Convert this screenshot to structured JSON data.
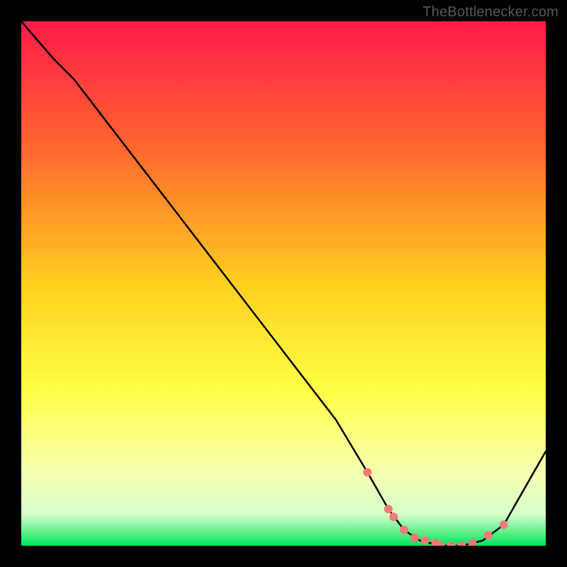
{
  "watermark": "TheBottlenecker.com",
  "chart_data": {
    "type": "line",
    "title": "",
    "xlabel": "",
    "ylabel": "",
    "xlim": [
      0,
      100
    ],
    "ylim": [
      0,
      100
    ],
    "background_gradient": {
      "stops": [
        {
          "offset": 0,
          "color": "#ff1a49"
        },
        {
          "offset": 25,
          "color": "#ff6a2e"
        },
        {
          "offset": 50,
          "color": "#ffcf1f"
        },
        {
          "offset": 70,
          "color": "#ffff44"
        },
        {
          "offset": 86,
          "color": "#f7ffb0"
        },
        {
          "offset": 94,
          "color": "#d6ffca"
        },
        {
          "offset": 100,
          "color": "#00e65a"
        }
      ]
    },
    "series": [
      {
        "name": "curve",
        "color": "#000000",
        "x": [
          0,
          6,
          10,
          20,
          30,
          40,
          50,
          60,
          66,
          70,
          73,
          76,
          80,
          84,
          88,
          92,
          100
        ],
        "values": [
          100,
          93,
          89,
          76,
          63,
          50,
          37,
          24,
          14,
          7,
          3,
          1,
          0,
          0,
          1,
          4,
          18
        ]
      }
    ],
    "markers": {
      "name": "dots",
      "color": "#f07a7a",
      "radius": 6,
      "x": [
        66,
        70,
        71,
        73,
        75,
        77,
        79,
        80,
        82,
        84,
        86,
        89,
        92
      ],
      "values": [
        14,
        7,
        5.5,
        3,
        1.5,
        1,
        0.5,
        0,
        0,
        0,
        0.5,
        2,
        4
      ]
    }
  }
}
